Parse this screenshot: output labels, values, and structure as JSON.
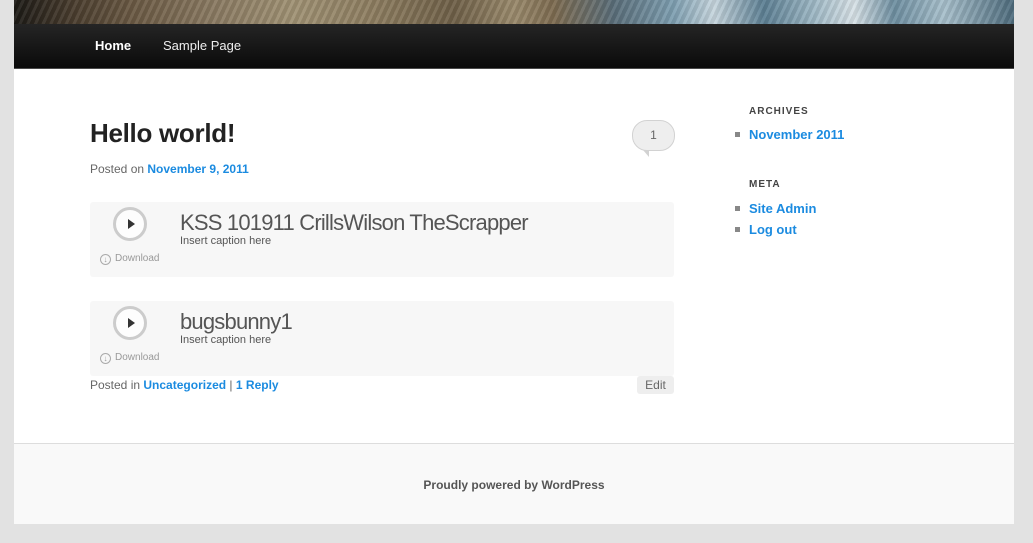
{
  "nav": {
    "home": "Home",
    "sample_page": "Sample Page"
  },
  "post": {
    "title": "Hello world!",
    "comment_count": "1",
    "posted_on_label": "Posted on",
    "date": "November 9, 2011",
    "audio": [
      {
        "title": "KSS 101911 CrillsWilson TheScrapper",
        "caption": "Insert caption here",
        "download": "Download"
      },
      {
        "title": "bugsbunny1",
        "caption": "Insert caption here",
        "download": "Download"
      }
    ],
    "posted_in_label": "Posted in",
    "category": "Uncategorized",
    "separator": "|",
    "reply": "1 Reply",
    "edit": "Edit"
  },
  "sidebar": {
    "archives_title": "ARCHIVES",
    "archives": [
      "November 2011"
    ],
    "meta_title": "META",
    "meta": [
      "Site Admin",
      "Log out"
    ]
  },
  "footer": {
    "text": "Proudly powered by WordPress"
  },
  "colors": {
    "link": "#1b8be0",
    "nav_bg": "#111111",
    "page_bg": "#e2e2e2"
  }
}
